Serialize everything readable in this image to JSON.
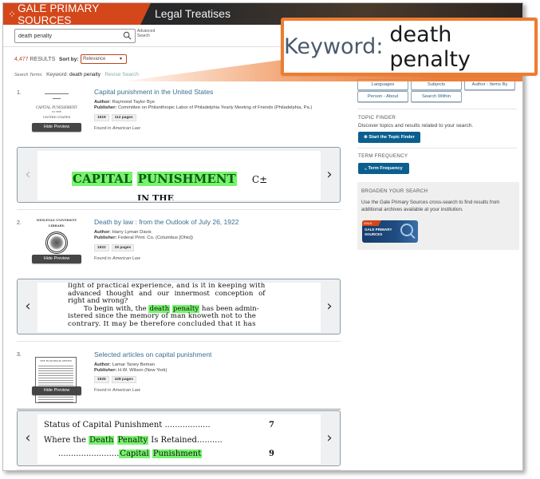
{
  "header": {
    "brand": "GALE PRIMARY SOURCES",
    "collection": "Legal Treatises",
    "brand_color": "#d4471a"
  },
  "search": {
    "value": "death penalty",
    "placeholder": "",
    "advanced_label_1": "Advanced",
    "advanced_label_2": "Search"
  },
  "results_bar": {
    "count": "4,477",
    "count_label": "RESULTS",
    "sort_label": "Sort by:",
    "sort_value": "Relevance",
    "search_terms_label": "Search Terms:",
    "keyword_label": "Keyword:",
    "keyword_value": "death penalty",
    "revise_label": "Revise Search"
  },
  "callout": {
    "label": "Keyword:",
    "value": "death penalty",
    "border_color": "#ed7d31"
  },
  "results": [
    {
      "number": "1.",
      "title": "Capital punishment in the United States",
      "author_label": "Author:",
      "author": "Raymond Taylor Bye",
      "publisher_label": "Publisher:",
      "publisher": "Committee on Philanthropic Labor of Philadelphia Yearly Meeting of Friends (Philadelphia, Pa.)",
      "year": "1919",
      "pages": "112 pages",
      "found_prefix": "Found in",
      "found_in": "American Law",
      "hide_preview": "Hide Preview",
      "thumb_lines": [
        "CAPITAL PUNISHMENT",
        "IN THE",
        "UNITED STATES"
      ],
      "preview": {
        "highlight_1": "CAPITAL",
        "highlight_2": "PUNISHMENT",
        "trail": "C±",
        "line_2": "IN THE"
      }
    },
    {
      "number": "2.",
      "title": "Death by law : from the Outlook of July 26, 1922",
      "author_label": "Author:",
      "author": "Harry Lyman Davis",
      "publisher_label": "Publisher:",
      "publisher": "Federal Print. Co. (Columbus [Ohio])",
      "year": "1922",
      "pages": "25 pages",
      "found_prefix": "Found in",
      "found_in": "American Law",
      "hide_preview": "Hide Preview",
      "thumb_lines": [
        "WESLEYAN UNIVERSITY",
        "LIBRARY."
      ],
      "preview": {
        "line_1": "light of practical experience, and is it in keeping with",
        "line_2": "advanced thought and our innermost conception of",
        "line_3": "right and wrong?",
        "line_4_pre": "To begin with, the",
        "highlight_1": "death",
        "highlight_2": "penalty",
        "line_4_post": "has been admin-",
        "line_5": "istered since the memory of man knoweth not to the",
        "line_6": "contrary.  It may be therefore concluded that it has"
      }
    },
    {
      "number": "3.",
      "title": "Selected articles on capital punishment",
      "author_label": "Author:",
      "author": "Lamar Taney Beman",
      "publisher_label": "Publisher:",
      "publisher": "H.W. Wilson (New York)",
      "year": "1925",
      "pages": "428 pages",
      "found_prefix": "Found in",
      "found_in": "American Law",
      "hide_preview": "Hide Preview",
      "thumb_lines": [
        "THE HANDBOOK SERIES"
      ],
      "preview": {
        "line_1": "Status of Capital Punishment ..................",
        "line_1_page": "7",
        "line_2_pre": "Where the",
        "highlight_1": "Death",
        "highlight_2": "Penalty",
        "line_2_post": "Is Retained..........",
        "line_3_dots": "........................",
        "highlight_3": "Capital",
        "highlight_4": "Punishment",
        "line_3_page": "9"
      }
    }
  ],
  "sidebar": {
    "filters": [
      "Languages",
      "Subjects",
      "Author - Items By",
      "Person - About",
      "Search Within"
    ],
    "topic_finder": {
      "heading": "TOPIC FINDER",
      "text": "Discover topics and results related to your search.",
      "button": "Start the Topic Finder"
    },
    "term_frequency": {
      "heading": "TERM FREQUENCY",
      "button": "Term Frequency"
    },
    "broaden": {
      "heading": "BROADEN YOUR SEARCH",
      "text_1": "Use the Gale Primary Sources cross-search to find results from",
      "text_2": "additional archives available at your institution.",
      "logo_tag": "GALE",
      "logo_line_1": "GALE PRIMARY",
      "logo_line_2": "SOURCES"
    },
    "button_color": "#0b5f8f"
  },
  "colors": {
    "link": "#3a6f8f",
    "highlight": "#77f36d",
    "accent": "#c0431b"
  }
}
